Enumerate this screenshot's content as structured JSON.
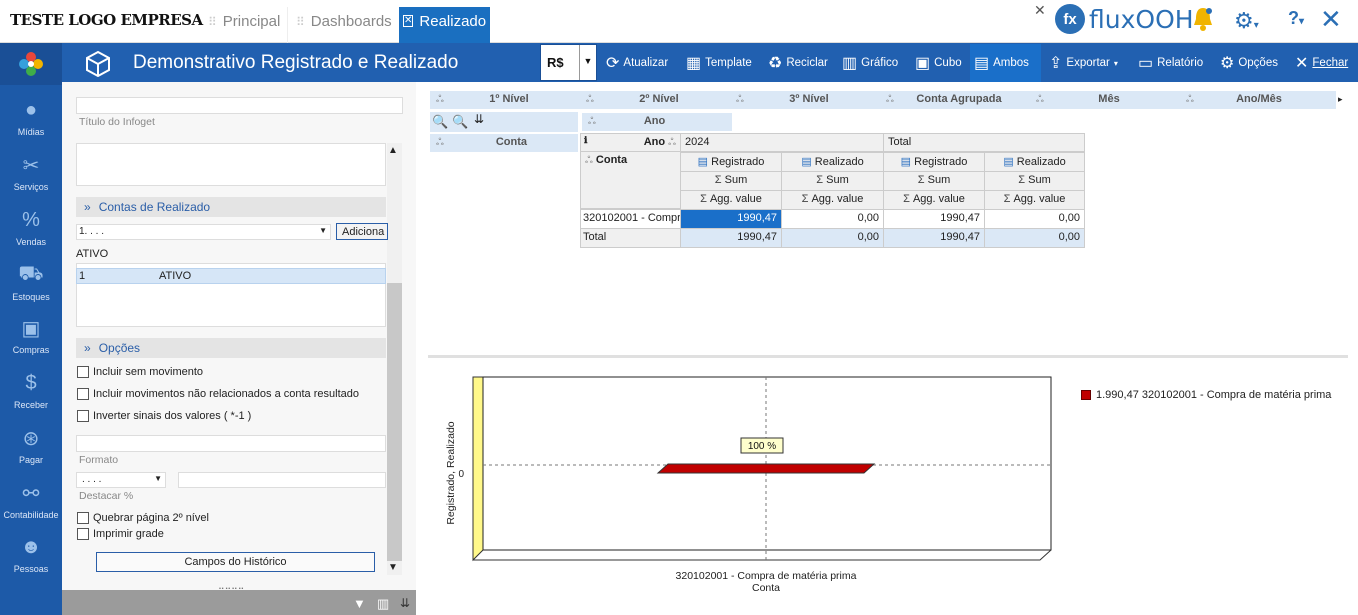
{
  "brand": {
    "logo_text": "TESTE LOGO EMPRESA",
    "product": "fluxOOH",
    "product_icon": "fluxooh-logo-icon"
  },
  "tabs": [
    {
      "label": "Principal"
    },
    {
      "label": "Dashboards"
    },
    {
      "label": "Realizado",
      "active": true
    }
  ],
  "topright": {
    "close_small": "✕",
    "help": "?",
    "close": "✕"
  },
  "nav": [
    {
      "label": "Mídias",
      "icon": "media-icon"
    },
    {
      "label": "Serviços",
      "icon": "tools-icon"
    },
    {
      "label": "Vendas",
      "icon": "percent-icon"
    },
    {
      "label": "Estoques",
      "icon": "dolly-icon"
    },
    {
      "label": "Compras",
      "icon": "box-icon"
    },
    {
      "label": "Receber",
      "icon": "coin-icon"
    },
    {
      "label": "Pagar",
      "icon": "hand-coin-icon"
    },
    {
      "label": "Contabilidade",
      "icon": "network-icon"
    },
    {
      "label": "Pessoas",
      "icon": "person-icon"
    }
  ],
  "title": "Demonstrativo Registrado e Realizado",
  "currency": "R$",
  "toolbar": {
    "atualizar": "Atualizar",
    "template": "Template",
    "reciclar": "Reciclar",
    "grafico": "Gráfico",
    "cubo": "Cubo",
    "ambos": "Ambos",
    "exportar": "Exportar",
    "relatorio": "Relatório",
    "opcoes": "Opções",
    "fechar": "Fechar"
  },
  "panel": {
    "titulo_label": "Título do Infoget",
    "contas_section": "Contas de Realizado",
    "select_value": "1. . . .",
    "add_button": "Adiciona",
    "ativo_label": "ATIVO",
    "list_row": {
      "code": "1",
      "name": "ATIVO"
    },
    "opcoes_section": "Opções",
    "chk1": "Incluir sem movimento",
    "chk2": "Incluir movimentos não relacionados a conta resultado",
    "chk3": "Inverter sinais dos valores ( *-1 )",
    "formato_label": "Formato",
    "destacar_value": ". . . .",
    "destacar_label": "Destacar %",
    "chk4": "Quebrar página 2º nível",
    "chk5": "Imprimir grade",
    "historico_button": "Campos do Histórico"
  },
  "pivot": {
    "filter_fields": [
      "1º Nível",
      "2º Nível",
      "3º Nível",
      "Conta Agrupada",
      "Mês",
      "Ano/Mês"
    ],
    "column_field": "Ano",
    "row_field": "Conta",
    "col_header_ano": "Ano",
    "year": "2024",
    "total_label": "Total",
    "row_header": "Conta",
    "measures": [
      "Registrado",
      "Realizado",
      "Registrado",
      "Realizado"
    ],
    "sum": "Sum",
    "agg": "Agg. value",
    "rows": [
      {
        "conta": "320102001 - Compra de matéria prima",
        "values": [
          "1990,47",
          "0,00",
          "1990,47",
          "0,00"
        ]
      },
      {
        "conta": "Total",
        "values": [
          "1990,47",
          "0,00",
          "1990,47",
          "0,00"
        ]
      }
    ]
  },
  "chart_data": {
    "type": "bar",
    "categories": [
      "320102001 - Compra de matéria prima"
    ],
    "series": [
      {
        "name": "1.990,47 320102001 - Compra de matéria prima",
        "values": [
          1990.47
        ]
      }
    ],
    "xlabel": "Conta",
    "ylabel": "Registrado, Realizado",
    "y_tick": "0",
    "percent_label": "100 %",
    "series_color": "#c00000",
    "legend_position": "right",
    "grid": true
  }
}
